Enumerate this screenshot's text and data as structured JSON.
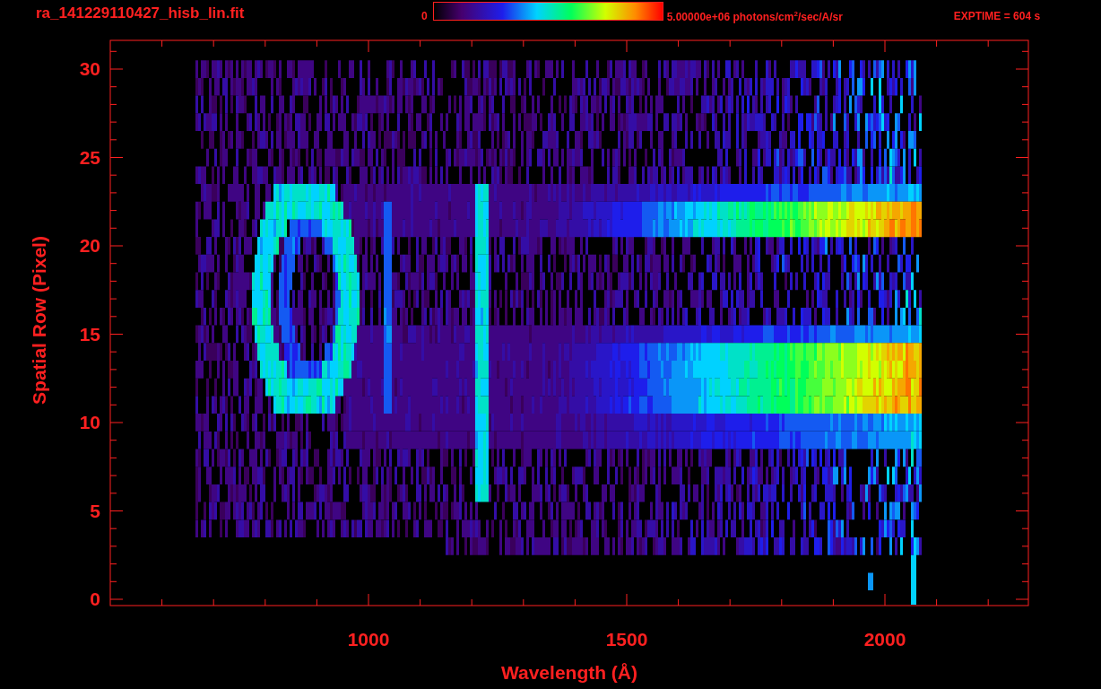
{
  "header": {
    "title": "ra_141229110427_hisb_lin.fit",
    "colorbar_min": "0",
    "colorbar_max": "5.00000e+06 photons/cm$^{2}$/sec/A/sr",
    "exposure": "EXPTIME = 604 s"
  },
  "plot": {
    "x_ticks": [
      "1000",
      "1500",
      "2000"
    ],
    "y_ticks": [
      "30",
      "25",
      "20",
      "15",
      "10",
      "5",
      "0"
    ],
    "xlabel": "Wavelength (Å)",
    "ylabel": "Spatial Row (Pixel)"
  }
}
